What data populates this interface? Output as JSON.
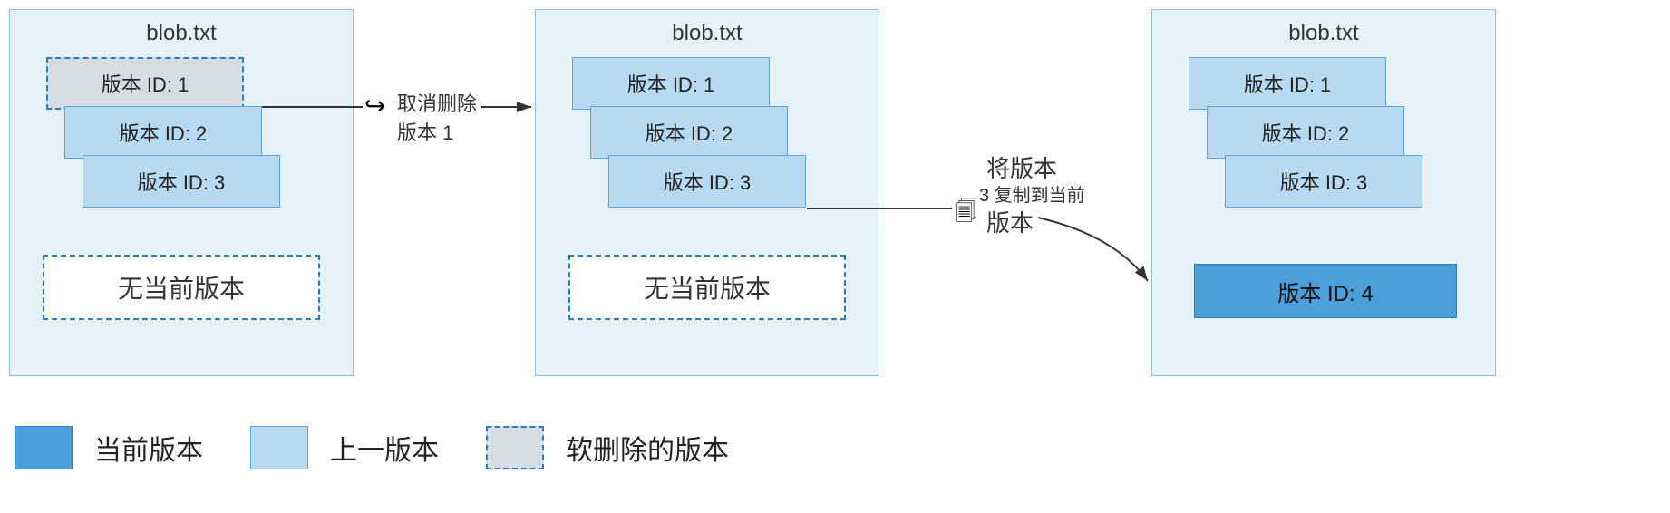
{
  "panels": [
    {
      "title": "blob.txt",
      "versions": [
        {
          "label": "版本 ID: 1",
          "state": "deleted"
        },
        {
          "label": "版本 ID: 2",
          "state": "prev"
        },
        {
          "label": "版本 ID: 3",
          "state": "prev"
        }
      ],
      "no_current": "无当前版本"
    },
    {
      "title": "blob.txt",
      "versions": [
        {
          "label": "版本 ID: 1",
          "state": "prev"
        },
        {
          "label": "版本 ID: 2",
          "state": "prev"
        },
        {
          "label": "版本 ID: 3",
          "state": "prev"
        }
      ],
      "no_current": "无当前版本"
    },
    {
      "title": "blob.txt",
      "versions": [
        {
          "label": "版本 ID: 1",
          "state": "prev"
        },
        {
          "label": "版本 ID: 2",
          "state": "prev"
        },
        {
          "label": "版本 ID: 3",
          "state": "prev"
        }
      ],
      "current": "版本 ID: 4"
    }
  ],
  "connectors": {
    "undelete": {
      "line1": "取消删除",
      "line2": "版本 1"
    },
    "copy": {
      "line1": "将版本",
      "line2": "3 复制到当前",
      "line3": "版本"
    }
  },
  "legend": {
    "current": "当前版本",
    "prev": "上一版本",
    "deleted": "软删除的版本"
  },
  "colors": {
    "panel_bg": "#e6f2fa",
    "prev_bg": "#b7daf2",
    "current_bg": "#4c9fd8",
    "deleted_bg": "#d5dde2",
    "border_blue": "#2a7bc2"
  }
}
